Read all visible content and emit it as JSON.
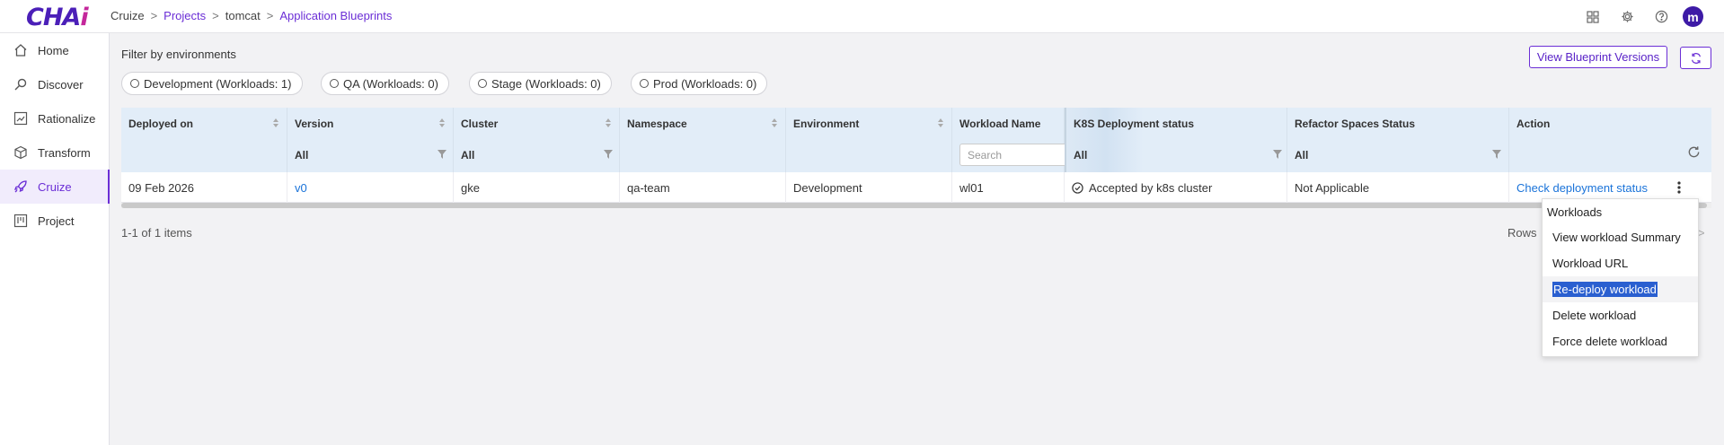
{
  "app": {
    "logo_main": "CHA",
    "logo_accent": "i"
  },
  "breadcrumb": [
    {
      "label": "Cruize",
      "link": false
    },
    {
      "label": "Projects",
      "link": true
    },
    {
      "label": "tomcat",
      "link": false
    },
    {
      "label": "Application Blueprints",
      "link": true
    }
  ],
  "header": {
    "avatar_initial": "m",
    "icons": [
      "grid-icon",
      "gear-icon",
      "help-icon"
    ]
  },
  "sidebar": {
    "items": [
      {
        "label": "Home",
        "icon": "home-icon",
        "active": false
      },
      {
        "label": "Discover",
        "icon": "discover-icon",
        "active": false
      },
      {
        "label": "Rationalize",
        "icon": "rationalize-icon",
        "active": false
      },
      {
        "label": "Transform",
        "icon": "cube-icon",
        "active": false
      },
      {
        "label": "Cruize",
        "icon": "rocket-icon",
        "active": true
      },
      {
        "label": "Project",
        "icon": "project-icon",
        "active": false
      }
    ]
  },
  "filters": {
    "title": "Filter by environments",
    "options": [
      "Development (Workloads: 1)",
      "QA (Workloads: 0)",
      "Stage (Workloads: 0)",
      "Prod (Workloads: 0)"
    ]
  },
  "actions": {
    "view_versions": "View Blueprint Versions"
  },
  "table": {
    "columns": [
      {
        "label": "Deployed on",
        "filter": ""
      },
      {
        "label": "Version",
        "filter": "All"
      },
      {
        "label": "Cluster",
        "filter": "All"
      },
      {
        "label": "Namespace",
        "filter": ""
      },
      {
        "label": "Environment",
        "filter": ""
      },
      {
        "label": "Workload Name",
        "filter": ""
      },
      {
        "label": "K8S Deployment status",
        "filter": "All"
      },
      {
        "label": "Refactor Spaces Status",
        "filter": "All"
      },
      {
        "label": "Action",
        "filter": ""
      }
    ],
    "search_placeholder": "Search",
    "rows": [
      {
        "deployed_on": "09 Feb 2026",
        "version": "v0",
        "cluster": "gke",
        "namespace": "qa-team",
        "environment": "Development",
        "workload_name": "wl01",
        "k8s_status": "Accepted by k8s cluster",
        "refactor_status": "Not Applicable",
        "action": "Check deployment status"
      }
    ]
  },
  "pagination": {
    "summary": "1-1 of 1 items",
    "rows_label": "Rows"
  },
  "menu": {
    "header": "Workloads",
    "items": [
      "View workload Summary",
      "Workload URL",
      "Re-deploy workload",
      "Delete workload",
      "Force delete workload"
    ]
  }
}
